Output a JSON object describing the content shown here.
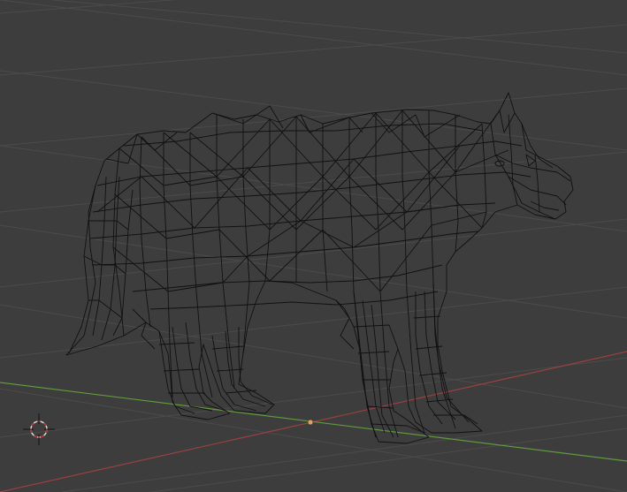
{
  "viewport": {
    "mode": "wireframe",
    "object": "wolf",
    "colors": {
      "background": "#3d3d3d",
      "grid": "#4b4b4b",
      "x_axis": "#9a4040",
      "y_axis": "#5f9a3c",
      "wire": "#111111",
      "cursor_ring_outer": "#d9d9d9",
      "cursor_ring_dash": "#c03030",
      "origin": "#e0a060"
    }
  }
}
